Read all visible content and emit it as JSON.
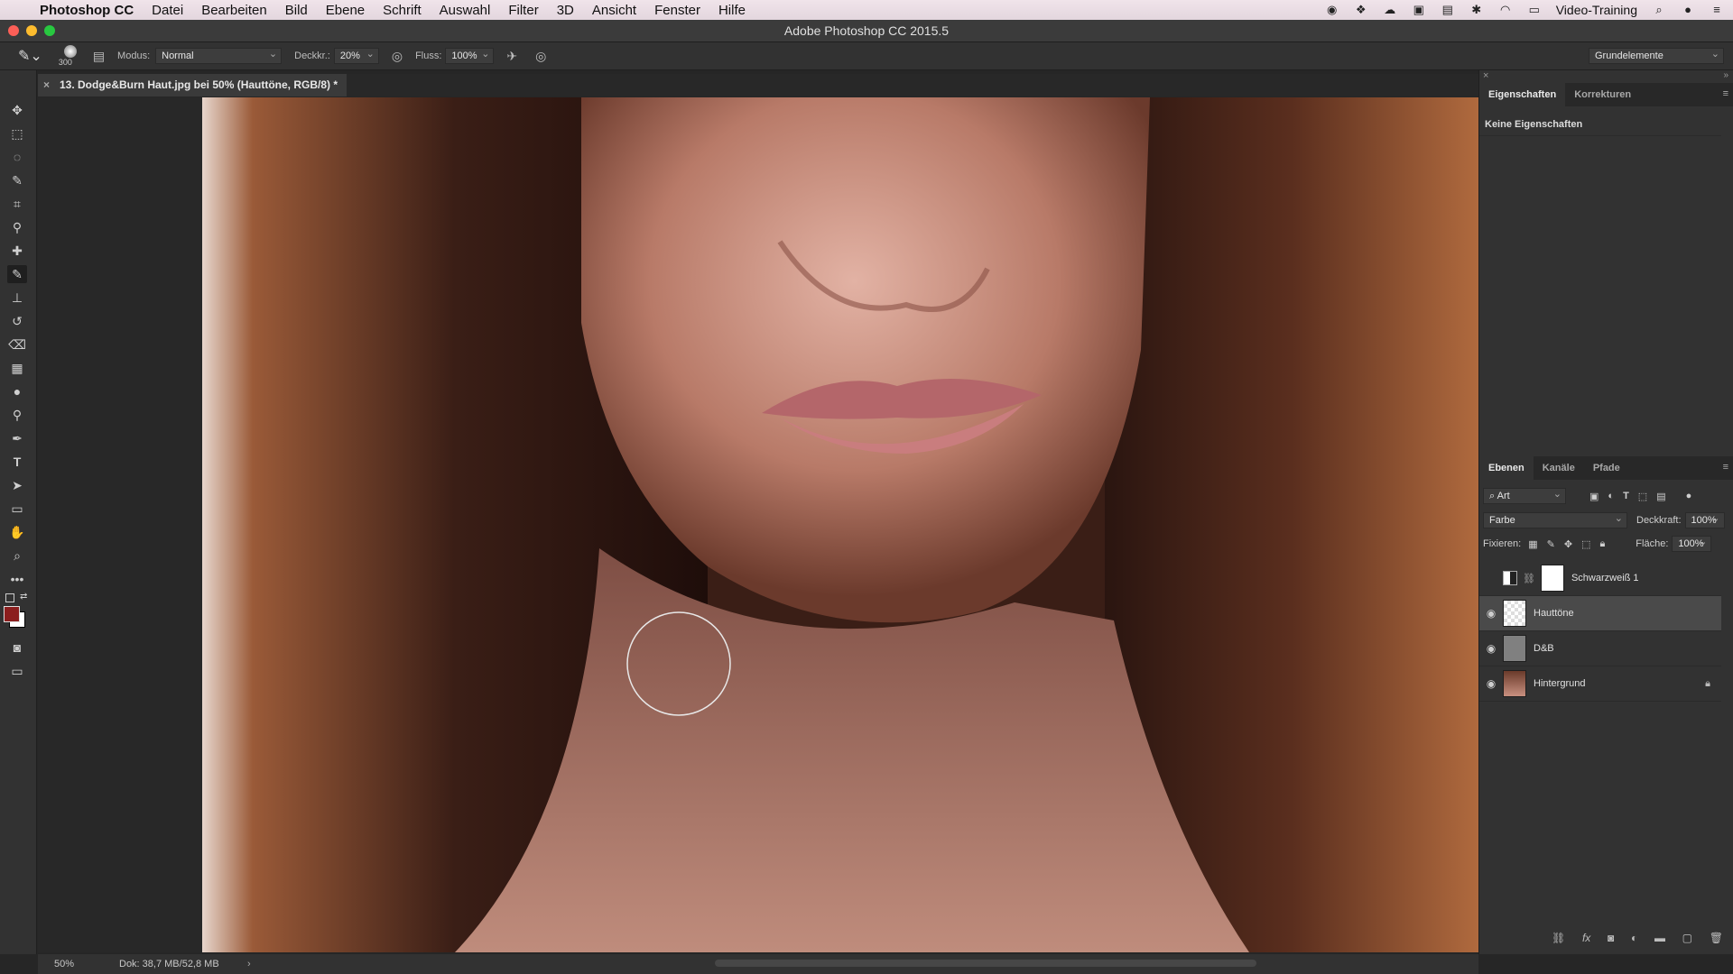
{
  "menubar": {
    "app": "Photoshop CC",
    "items": [
      "Datei",
      "Bearbeiten",
      "Bild",
      "Ebene",
      "Schrift",
      "Auswahl",
      "Filter",
      "3D",
      "Ansicht",
      "Fenster",
      "Hilfe"
    ],
    "user": "Video-Training"
  },
  "window": {
    "title": "Adobe Photoshop CC 2015.5"
  },
  "options": {
    "brush_size": "300",
    "mode_label": "Modus:",
    "mode_value": "Normal",
    "opacity_label": "Deckkr.:",
    "opacity_value": "20%",
    "flow_label": "Fluss:",
    "flow_value": "100%",
    "workspace": "Grundelemente"
  },
  "document": {
    "tab_title": "13. Dodge&Burn Haut.jpg bei 50% (Hauttöne, RGB/8) *"
  },
  "properties": {
    "tabs": [
      "Eigenschaften",
      "Korrekturen"
    ],
    "empty_text": "Keine Eigenschaften"
  },
  "layers_panel": {
    "tabs": [
      "Ebenen",
      "Kanäle",
      "Pfade"
    ],
    "filter": "Art",
    "blend_mode": "Farbe",
    "opacity_label": "Deckkraft:",
    "opacity_value": "100%",
    "lock_label": "Fixieren:",
    "fill_label": "Fläche:",
    "fill_value": "100%",
    "layers": [
      {
        "name": "Schwarzweiß 1",
        "visible": false
      },
      {
        "name": "Hauttöne",
        "visible": true
      },
      {
        "name": "D&B",
        "visible": true
      },
      {
        "name": "Hintergrund",
        "visible": true
      }
    ]
  },
  "status": {
    "zoom": "50%",
    "doc_info": "Dok: 38,7 MB/52,8 MB"
  },
  "colors": {
    "foreground": "#8b1e1e",
    "background": "#ffffff",
    "accent": "#4a4a4a"
  }
}
